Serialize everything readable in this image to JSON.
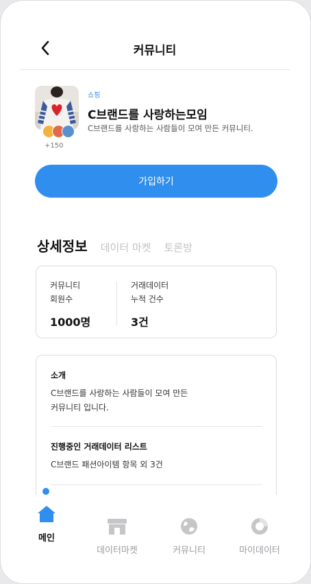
{
  "header": {
    "title": "커뮤니티",
    "back_icon": "chevron-left-icon"
  },
  "community": {
    "category": "쇼핑",
    "name": "C브랜드를 사랑하는모임",
    "description": "C브랜드를 사랑하는 사람들이 모여 만든 커뮤니티.",
    "member_extra": "+150"
  },
  "join_button": "가입하기",
  "tabs": [
    {
      "label": "상세정보",
      "active": true
    },
    {
      "label": "데이터 마켓",
      "active": false
    },
    {
      "label": "토론방",
      "active": false
    }
  ],
  "stats": [
    {
      "label_line1": "커뮤니티",
      "label_line2": "회원수",
      "value": "1000명"
    },
    {
      "label_line1": "거래데이터",
      "label_line2": "누적 건수",
      "value": "3건"
    }
  ],
  "details": {
    "intro_title": "소개",
    "intro_line1": "C브랜드를 사랑하는 사람들이 모여 만든",
    "intro_line2": "커뮤니티 입니다.",
    "list_title": "진행중인 거래데이터 리스트",
    "list_body": "C브랜드 패션아이템 항목 외 3건"
  },
  "bottom_nav": [
    {
      "label": "메인",
      "icon": "home-icon",
      "active": true
    },
    {
      "label": "데이터마켓",
      "icon": "store-icon",
      "active": false
    },
    {
      "label": "커뮤니티",
      "icon": "globe-icon",
      "active": false
    },
    {
      "label": "마이데이터",
      "icon": "donut-chart-icon",
      "active": false
    }
  ],
  "colors": {
    "accent": "#2f8eee",
    "inactive": "#c2c2c6",
    "nav_icon": "#c6c6c9"
  }
}
